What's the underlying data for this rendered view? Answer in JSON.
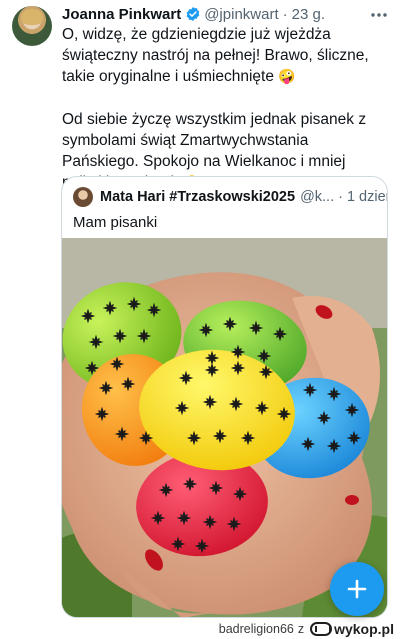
{
  "tweet": {
    "author_name": "Joanna Pinkwart",
    "handle": "@jpinkwart",
    "separator": "·",
    "time": "23 g.",
    "more_icon": "more-horizontal-icon",
    "verified_icon": "verified-badge-icon",
    "paragraph1": "O, widzę, że gdzieniegdzie już wjeżdża świąteczny nastrój na pełnej! Brawo, śliczne, takie oryginalne i uśmiechnięte",
    "paragraph1_emoji": "🤪",
    "paragraph2": "Od siebie życzę wszystkim jednak pisanek z symbolami świąt Zmartwychwstania Pańskiego. Spokojo na Wielkanoc i mniej polityki, Kochani!",
    "paragraph2_emoji_end": "🐣",
    "paragraph2_emoji_line": "🐇🐑"
  },
  "quoted": {
    "author_name": "Mata Hari #Trzaskowski2025",
    "handle": "@k...",
    "separator": "·",
    "time": "1 dzień",
    "text": "Mam pisanki"
  },
  "compose_button": {
    "icon": "plus-icon",
    "label": "+"
  },
  "footer": {
    "username": "badreligion66",
    "connector": "z",
    "site": "wykop.pl",
    "logo_icon": "wykop-logo-icon"
  },
  "colors": {
    "accent": "#1d9bf0",
    "text": "#0f1419",
    "secondary": "#536471",
    "border": "#cfd9de"
  }
}
